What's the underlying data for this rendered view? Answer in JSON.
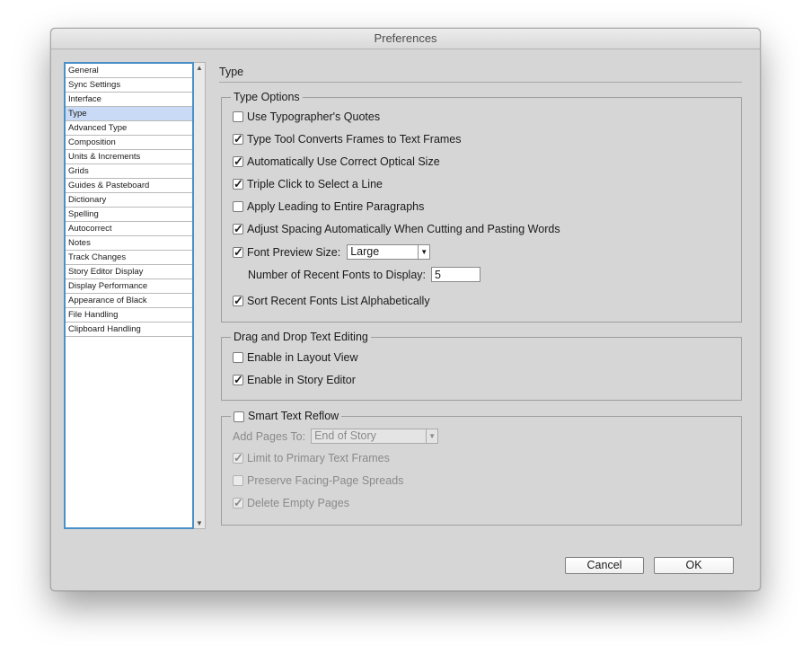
{
  "window": {
    "title": "Preferences"
  },
  "sidebar": {
    "items": [
      {
        "label": "General"
      },
      {
        "label": "Sync Settings"
      },
      {
        "label": "Interface"
      },
      {
        "label": "Type",
        "selected": true
      },
      {
        "label": "Advanced Type"
      },
      {
        "label": "Composition"
      },
      {
        "label": "Units & Increments"
      },
      {
        "label": "Grids"
      },
      {
        "label": "Guides & Pasteboard"
      },
      {
        "label": "Dictionary"
      },
      {
        "label": "Spelling"
      },
      {
        "label": "Autocorrect"
      },
      {
        "label": "Notes"
      },
      {
        "label": "Track Changes"
      },
      {
        "label": "Story Editor Display"
      },
      {
        "label": "Display Performance"
      },
      {
        "label": "Appearance of Black"
      },
      {
        "label": "File Handling"
      },
      {
        "label": "Clipboard Handling"
      }
    ]
  },
  "panel": {
    "title": "Type"
  },
  "type_options": {
    "legend": "Type Options",
    "use_typographers_quotes": {
      "label": "Use Typographer's Quotes",
      "checked": false
    },
    "type_tool_converts": {
      "label": "Type Tool Converts Frames to Text Frames",
      "checked": true
    },
    "auto_optical_size": {
      "label": "Automatically Use Correct Optical Size",
      "checked": true
    },
    "triple_click_line": {
      "label": "Triple Click to Select a Line",
      "checked": true
    },
    "apply_leading": {
      "label": "Apply Leading to Entire Paragraphs",
      "checked": false
    },
    "adjust_spacing": {
      "label": "Adjust Spacing Automatically When Cutting and Pasting Words",
      "checked": true
    },
    "font_preview": {
      "label": "Font Preview Size:",
      "checked": true,
      "value": "Large"
    },
    "recent_fonts": {
      "label": "Number of Recent Fonts to Display:",
      "value": "5"
    },
    "sort_recent_fonts": {
      "label": "Sort Recent Fonts List Alphabetically",
      "checked": true
    }
  },
  "drag_drop": {
    "legend": "Drag and Drop Text Editing",
    "layout_view": {
      "label": "Enable in Layout View",
      "checked": false
    },
    "story_editor": {
      "label": "Enable in Story Editor",
      "checked": true
    }
  },
  "smart_reflow": {
    "legend": "Smart Text Reflow",
    "checked": false,
    "add_pages_label": "Add Pages To:",
    "add_pages_value": "End of Story",
    "limit_primary": {
      "label": "Limit to Primary Text Frames",
      "checked": true
    },
    "preserve_spreads": {
      "label": "Preserve Facing-Page Spreads",
      "checked": false
    },
    "delete_empty": {
      "label": "Delete Empty Pages",
      "checked": true
    }
  },
  "buttons": {
    "cancel": "Cancel",
    "ok": "OK"
  }
}
